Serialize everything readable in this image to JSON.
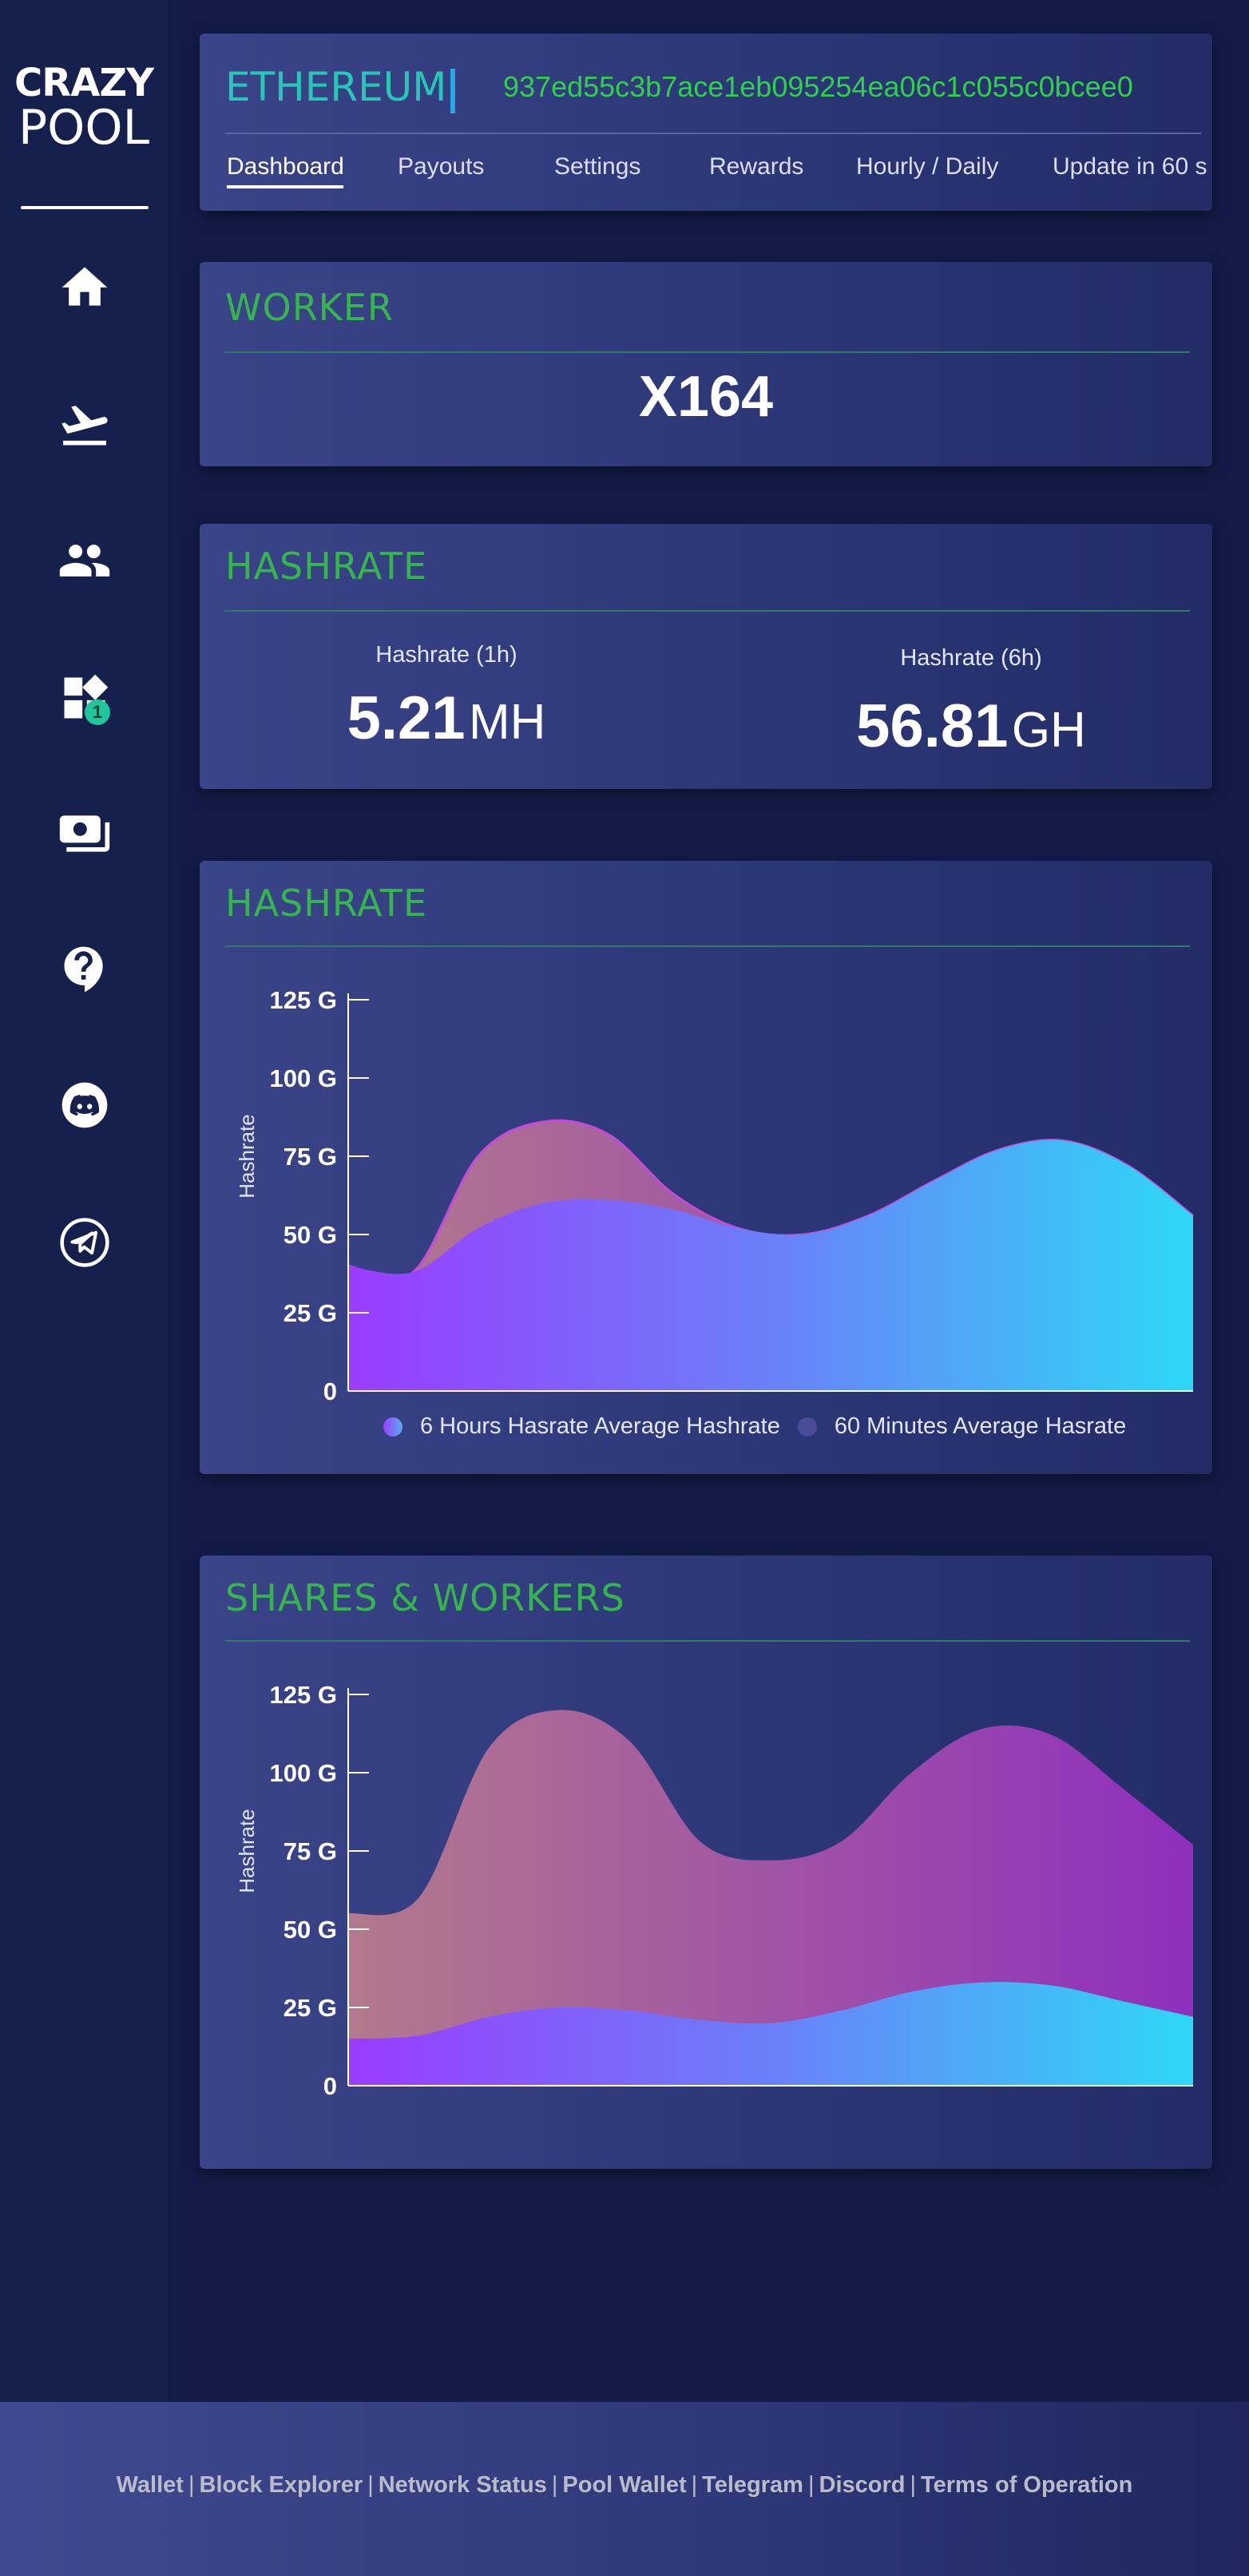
{
  "brand": {
    "line1": "CRAZY",
    "line2": "POOL"
  },
  "sidebar": {
    "items": [
      {
        "icon": "home-icon",
        "badge": ""
      },
      {
        "icon": "airplane-takeoff-icon",
        "badge": ""
      },
      {
        "icon": "users-icon",
        "badge": ""
      },
      {
        "icon": "widgets-icon",
        "badge": "1"
      },
      {
        "icon": "payments-icon",
        "badge": ""
      },
      {
        "icon": "help-icon",
        "badge": ""
      },
      {
        "icon": "discord-icon",
        "badge": ""
      },
      {
        "icon": "telegram-icon",
        "badge": ""
      }
    ],
    "badge_color": "#21c59b"
  },
  "header": {
    "coin": "ETHEREUM",
    "address": "937ed55c3b7ace1eb095254ea06c1c055c0bcee0",
    "tabs": [
      {
        "label": "Dashboard",
        "active": true
      },
      {
        "label": "Payouts",
        "active": false
      },
      {
        "label": "Settings",
        "active": false
      },
      {
        "label": "Rewards",
        "active": false
      },
      {
        "label": "Hourly / Daily",
        "active": false
      },
      {
        "label": "Update in 60 s",
        "active": false
      }
    ]
  },
  "worker": {
    "title": "WORKER",
    "name": "X164"
  },
  "hashrate_stats": {
    "title": "HASHRATE",
    "h1_label": "Hashrate (1h)",
    "h1_value": "5.21",
    "h1_unit": "MH",
    "h6_label": "Hashrate (6h)",
    "h6_value": "56.81",
    "h6_unit": "GH"
  },
  "hashrate_chart": {
    "title": "HASHRATE"
  },
  "shares_chart": {
    "title": "SHARES & WORKERS"
  },
  "chart_data": [
    {
      "type": "area",
      "ylabel": "Hashrate",
      "ylim": [
        0,
        125
      ],
      "yticks": [
        "0",
        "25 G",
        "50 G",
        "75 G",
        "100 G",
        "125 G"
      ],
      "x": [
        0,
        1,
        2,
        3,
        4,
        5,
        6,
        7,
        8,
        9,
        10
      ],
      "series": [
        {
          "name": "6 Hours Hasrate Average Hashrate",
          "values": [
            40,
            38,
            52,
            60,
            61,
            58,
            52,
            50,
            56,
            67,
            77
          ]
        },
        {
          "name": "60 Minutes Average  Hasrate",
          "values": [
            40,
            38,
            75,
            86,
            82,
            63,
            52,
            50,
            56,
            67,
            77
          ]
        }
      ],
      "tail": {
        "x": [
          11,
          12
        ],
        "values": [
          80,
          72
        ]
      },
      "end_value": 56,
      "legend_position": "bottom",
      "colors": {
        "base_start": "#9a3cff",
        "base_mid": "#6a80f8",
        "base_end": "#2ed8f6",
        "top_start": "#b27a8c",
        "top_end": "#8f2fbd",
        "legend_dot1": "#5aaef0",
        "legend_dot2": "#4a4c9a"
      }
    },
    {
      "type": "area",
      "ylabel": "Hashrate",
      "ylim": [
        0,
        125
      ],
      "yticks": [
        "0",
        "25 G",
        "50 G",
        "75 G",
        "100 G",
        "125 G"
      ],
      "series": [
        {
          "name": "",
          "values": [
            15,
            16,
            22,
            25,
            24,
            21,
            20,
            24,
            30,
            33,
            32,
            27,
            22
          ]
        },
        {
          "name": "",
          "values": [
            55,
            60,
            108,
            120,
            110,
            78,
            72,
            78,
            100,
            114,
            112,
            95,
            77
          ]
        }
      ],
      "legend_position": "none",
      "colors": {
        "base_start": "#9a3cff",
        "base_mid": "#6a80f8",
        "base_end": "#2ed8f6",
        "top_start": "#b27a8c",
        "top_end": "#8f2fbd"
      }
    }
  ],
  "footer": {
    "links": [
      "Wallet",
      "Block Explorer",
      "Network Status",
      "Pool Wallet",
      "Telegram",
      "Discord",
      "Terms of Operation"
    ]
  }
}
